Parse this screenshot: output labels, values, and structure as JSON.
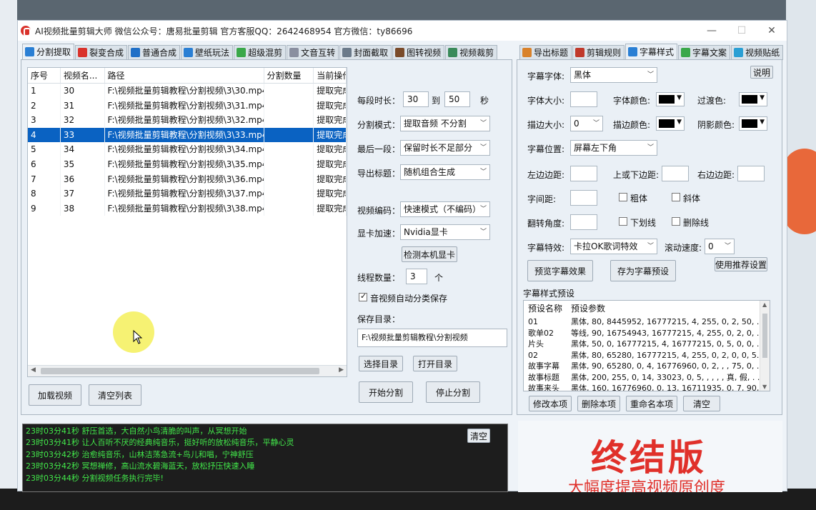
{
  "window": {
    "title": "AI视频批量剪辑大师   微信公众号：唐易批量剪辑   官方客服QQ：2642468954   官方微信：ty86696",
    "controls": [
      "—",
      "☐",
      "✕"
    ]
  },
  "left_tabs": [
    {
      "label": "分割提取",
      "active": true,
      "icon_color": "#2a7fd4"
    },
    {
      "label": "裂变合成",
      "active": false,
      "icon_color": "#d9322b"
    },
    {
      "label": "普通合成",
      "active": false,
      "icon_color": "#1f6fc7"
    },
    {
      "label": "壁纸玩法",
      "active": false,
      "icon_color": "#2a7fd4"
    },
    {
      "label": "超级混剪",
      "active": false,
      "icon_color": "#3aa84a"
    },
    {
      "label": "文音互转",
      "active": false,
      "icon_color": "#8a8fa0"
    },
    {
      "label": "封面截取",
      "active": false,
      "icon_color": "#6b7a8a"
    },
    {
      "label": "图转视频",
      "active": false,
      "icon_color": "#7a4b2a"
    },
    {
      "label": "视频裁剪",
      "active": false,
      "icon_color": "#3a8a5a"
    }
  ],
  "right_tabs": [
    {
      "label": "导出标题",
      "active": false,
      "icon_color": "#d9822b"
    },
    {
      "label": "剪辑规则",
      "active": false,
      "icon_color": "#c0392b"
    },
    {
      "label": "字幕样式",
      "active": true,
      "icon_color": "#2a7fd4"
    },
    {
      "label": "字幕文案",
      "active": false,
      "icon_color": "#3aa84a"
    },
    {
      "label": "视频贴纸",
      "active": false,
      "icon_color": "#2a9fd4"
    }
  ],
  "table": {
    "headers": [
      "序号",
      "视频名...",
      "路径",
      "分割数量",
      "当前操作"
    ],
    "rows": [
      {
        "idx": "1",
        "name": "30",
        "path": "F:\\视频批量剪辑教程\\分割视频\\3\\30.mp4",
        "count": "",
        "status": "提取完成",
        "selected": false
      },
      {
        "idx": "2",
        "name": "31",
        "path": "F:\\视频批量剪辑教程\\分割视频\\3\\31.mp4",
        "count": "",
        "status": "提取完成",
        "selected": false
      },
      {
        "idx": "3",
        "name": "32",
        "path": "F:\\视频批量剪辑教程\\分割视频\\3\\32.mp4",
        "count": "",
        "status": "提取完成",
        "selected": false
      },
      {
        "idx": "4",
        "name": "33",
        "path": "F:\\视频批量剪辑教程\\分割视频\\3\\33.mp4",
        "count": "",
        "status": "提取完成",
        "selected": true
      },
      {
        "idx": "5",
        "name": "34",
        "path": "F:\\视频批量剪辑教程\\分割视频\\3\\34.mp4",
        "count": "",
        "status": "提取完成",
        "selected": false
      },
      {
        "idx": "6",
        "name": "35",
        "path": "F:\\视频批量剪辑教程\\分割视频\\3\\35.mp4",
        "count": "",
        "status": "提取完成",
        "selected": false
      },
      {
        "idx": "7",
        "name": "36",
        "path": "F:\\视频批量剪辑教程\\分割视频\\3\\36.mp4",
        "count": "",
        "status": "提取完成",
        "selected": false
      },
      {
        "idx": "8",
        "name": "37",
        "path": "F:\\视频批量剪辑教程\\分割视频\\3\\37.mp4",
        "count": "",
        "status": "提取完成",
        "selected": false
      },
      {
        "idx": "9",
        "name": "38",
        "path": "F:\\视频批量剪辑教程\\分割视频\\3\\38.mp4",
        "count": "",
        "status": "提取完成",
        "selected": false
      }
    ]
  },
  "list_buttons": {
    "add": "加载视频",
    "clear": "清空列表"
  },
  "split_settings": {
    "duration_label": "每段时长：",
    "duration_from": "30",
    "to_label": "到",
    "duration_to": "50",
    "sec_label": "秒",
    "mode_label": "分割模式：",
    "mode_value": "提取音频 不分割",
    "last_label": "最后一段：",
    "last_value": "保留时长不足部分",
    "export_title_label": "导出标题：",
    "export_title_value": "随机组合生成",
    "codec_label": "视频编码：",
    "codec_value": "快速模式（不编码）",
    "gpu_label": "显卡加速：",
    "gpu_value": "Nvidia显卡",
    "detect_gpu": "检测本机显卡",
    "threads_label": "线程数量：",
    "threads_value": "3",
    "threads_unit": "个",
    "auto_save_label": "音视频自动分类保存",
    "auto_save_checked": true,
    "save_dir_label": "保存目录：",
    "save_dir_value": "F:\\视频批量剪辑教程\\分割视频",
    "choose_dir": "选择目录",
    "open_dir": "打开目录",
    "start": "开始分割",
    "stop": "停止分割"
  },
  "subtitle": {
    "font_label": "字幕字体:",
    "font_value": "黑体",
    "help": "说明",
    "size_label": "字体大小:",
    "size_value": "",
    "color_label": "字体颜色:",
    "fade_label": "过渡色:",
    "outline_size_label": "描边大小:",
    "outline_size_value": "0",
    "outline_color_label": "描边颜色:",
    "shadow_color_label": "阴影颜色:",
    "position_label": "字幕位置:",
    "position_value": "屏幕左下角",
    "margin_left_label": "左边边距:",
    "margin_v_label": "上或下边距:",
    "margin_right_label": "右边边距:",
    "spacing_label": "字间距:",
    "bold_label": "粗体",
    "italic_label": "斜体",
    "rotate_label": "翻转角度:",
    "underline_label": "下划线",
    "strike_label": "删除线",
    "effect_label": "字幕特效:",
    "effect_value": "卡拉OK歌词特效",
    "scroll_label": "滚动速度:",
    "scroll_value": "0",
    "use_recommended": "使用推荐设置",
    "preview": "预览字幕效果",
    "save_preset": "存为字幕预设",
    "preset_section": "字幕样式预设",
    "preset_headers": [
      "预设名称",
      "预设参数"
    ],
    "presets": [
      {
        "name": "01",
        "params": "黑体, 80, 8445952, 16777215, 4, 255, 0, 2, 50, . . ."
      },
      {
        "name": "歌单02",
        "params": "等线, 90, 16754943, 16777215, 4, 255, 0, 2, 0, . . ."
      },
      {
        "name": "片头",
        "params": "黑体, 50, 0, 16777215, 4, 16777215, 0, 5, 0, 0, . . ."
      },
      {
        "name": "02",
        "params": "黑体, 80, 65280, 16777215, 4, 255, 0, 2, 0, 0, 5. . ."
      },
      {
        "name": "故事字幕",
        "params": "黑体, 90, 65280, 0, 4, 16776960, 0, 2, , , 75, 0, . . ."
      },
      {
        "name": "故事标题",
        "params": "黑体, 200, 255, 0, 14, 33023, 0, 5, , , , , 真, 假, . . ."
      },
      {
        "name": "故事来头",
        "params": "黑体, 160, 16776960, 0, 13, 16711935, 0, 7, 90, . . ."
      }
    ],
    "edit": "修改本项",
    "delete": "删除本项",
    "rename": "重命名本项",
    "clear": "清空"
  },
  "log": {
    "clear": "清空",
    "lines": [
      "23时03分41秒 舒压首选，大自然小鸟清脆的叫声，从冥想开始",
      "23时03分41秒 让人百听不厌的经典纯音乐，挺好听的放松纯音乐，平静心灵",
      "23时03分42秒 治愈纯音乐，山林洁荡急流+鸟儿和唱，宁神舒压",
      "23时03分42秒 冥想禅修，高山流水碧海蓝天，放松抒压快速入睡",
      "23时03分44秒 分割视频任务执行完毕!"
    ]
  },
  "banner": {
    "title": "终结版",
    "subtitle": "大幅度提高视频原创度"
  }
}
